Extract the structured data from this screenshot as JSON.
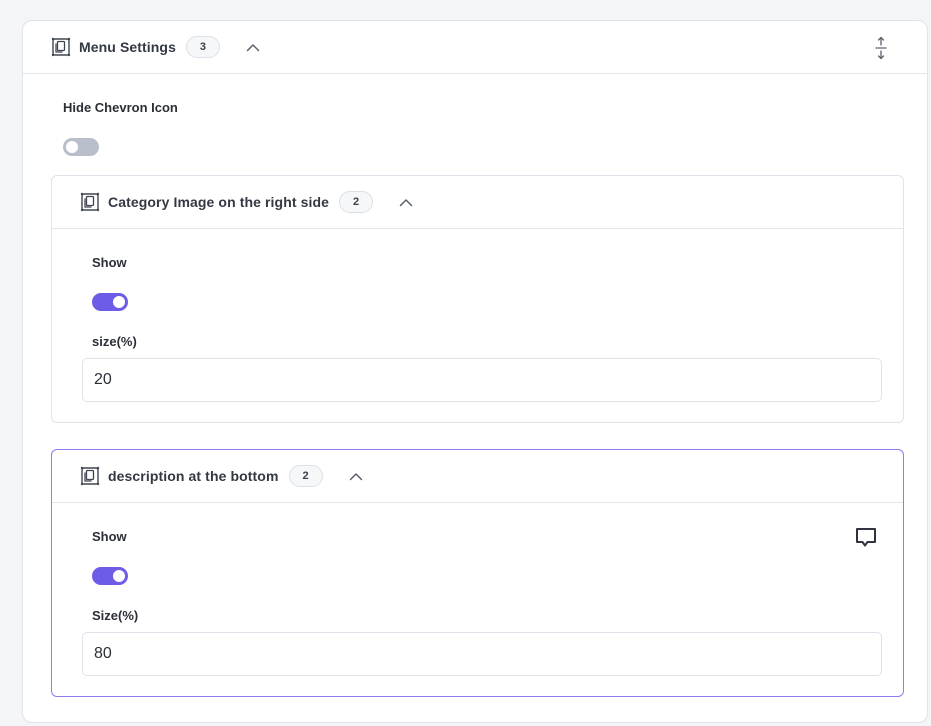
{
  "menu_settings": {
    "title": "Menu Settings",
    "count": "3",
    "hide_chevron": {
      "label": "Hide Chevron Icon",
      "enabled": false
    }
  },
  "category_image": {
    "title": "Category Image on the right side",
    "count": "2",
    "show_label": "Show",
    "show_enabled": true,
    "size_label": "size(%)",
    "size_value": "20"
  },
  "description_bottom": {
    "title": "description at the bottom",
    "count": "2",
    "show_label": "Show",
    "show_enabled": true,
    "size_label": "Size(%)",
    "size_value": "80"
  },
  "icons": {
    "card": "card-copy-icon",
    "chevron": "chevron-up-icon",
    "resize": "vertical-resize-icon",
    "comment": "comment-icon"
  },
  "colors": {
    "accent": "#6c5ce7",
    "active_border": "#8b7ef0",
    "toggle_off": "#b9bfca"
  }
}
